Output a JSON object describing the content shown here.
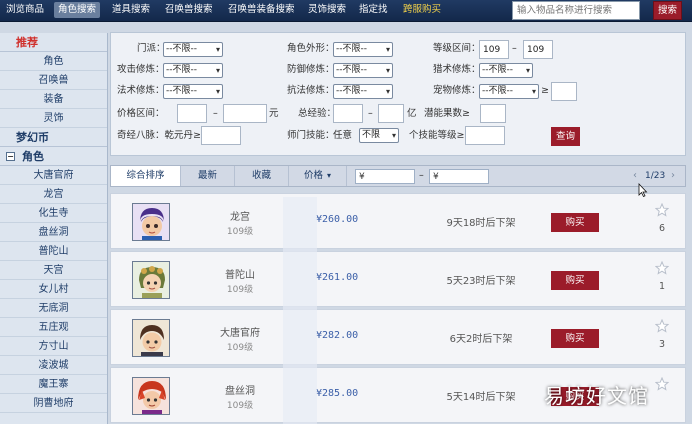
{
  "top_nav": {
    "items": [
      {
        "label": "浏览商品",
        "active": false
      },
      {
        "label": "角色搜索",
        "active": true
      },
      {
        "label": "道具搜索",
        "active": false
      },
      {
        "label": "召唤兽搜索",
        "active": false
      },
      {
        "label": "召唤兽装备搜索",
        "active": false
      },
      {
        "label": "灵饰搜索",
        "active": false
      },
      {
        "label": "指定找",
        "active": false
      },
      {
        "label": "跨服购买",
        "active": false,
        "highlight": true
      }
    ],
    "search_placeholder": "输入物品名称进行搜索",
    "search_button": "搜索"
  },
  "sidebar": {
    "recommend_title": "推荐",
    "recommend_items": [
      "角色",
      "召唤兽",
      "装备",
      "灵饰"
    ],
    "currency": "梦幻币",
    "role_category": "角色",
    "role_collapse_symbol": "−",
    "schools": [
      "大唐官府",
      "龙宫",
      "化生寺",
      "盘丝洞",
      "普陀山",
      "天宫",
      "女儿村",
      "无底洞",
      "五庄观",
      "方寸山",
      "凌波城",
      "魔王寨",
      "阴曹地府"
    ]
  },
  "filters": {
    "school_label": "门派：",
    "school_value": "--不限--",
    "appearance_label": "角色外形：",
    "appearance_value": "--不限--",
    "level_label": "等级区间：",
    "level_min": "109",
    "level_sep": "–",
    "level_max": "109",
    "attack_label": "攻击修炼：",
    "attack_value": "--不限--",
    "defense_label": "防御修炼：",
    "defense_value": "--不限--",
    "beast_label": "猎术修炼：",
    "beast_value": "--不限--",
    "magic_label": "法术修炼：",
    "magic_value": "--不限--",
    "resist_label": "抗法修炼：",
    "resist_value": "--不限--",
    "pet_label": "宠物修炼：",
    "pet_value": "--不限--",
    "pet_ge": "≥",
    "price_label": "价格区间：",
    "price_sep": "–",
    "price_unit": "元",
    "exp_label": "总经验：",
    "exp_sep": "–",
    "exp_unit": "亿",
    "potential_label": "潜能果数≥",
    "qiannv_label": "奇经八脉：乾元丹≥",
    "master_label": "师门技能：",
    "master_any": "任意",
    "master_value": "不限",
    "master_level_label": "个技能等级≥",
    "query_button": "查询"
  },
  "sort_bar": {
    "tabs": [
      "综合排序",
      "最新",
      "收藏",
      "价格"
    ],
    "price_min_prefix": "¥",
    "price_sep": "–",
    "price_max_prefix": "¥",
    "page": "1/23",
    "prev_icon": "‹",
    "next_icon": "›"
  },
  "listings": [
    {
      "school": "龙宫",
      "level": "109级",
      "price": "¥260.00",
      "time": "9天18时后下架",
      "buy": "购买",
      "favorites": "6"
    },
    {
      "school": "普陀山",
      "level": "109级",
      "price": "¥261.00",
      "time": "5天23时后下架",
      "buy": "购买",
      "favorites": "1"
    },
    {
      "school": "大唐官府",
      "level": "109级",
      "price": "¥282.00",
      "time": "6天2时后下架",
      "buy": "购买",
      "favorites": "3"
    },
    {
      "school": "盘丝洞",
      "level": "109级",
      "price": "¥285.00",
      "time": "5天14时后下架",
      "buy": "购买",
      "favorites": ""
    }
  ],
  "watermark": "易坊好文馆",
  "colors": {
    "accent": "#9b1c2a",
    "nav": "#1a3258",
    "link": "#1f3d68",
    "price": "#3b5fa8"
  }
}
